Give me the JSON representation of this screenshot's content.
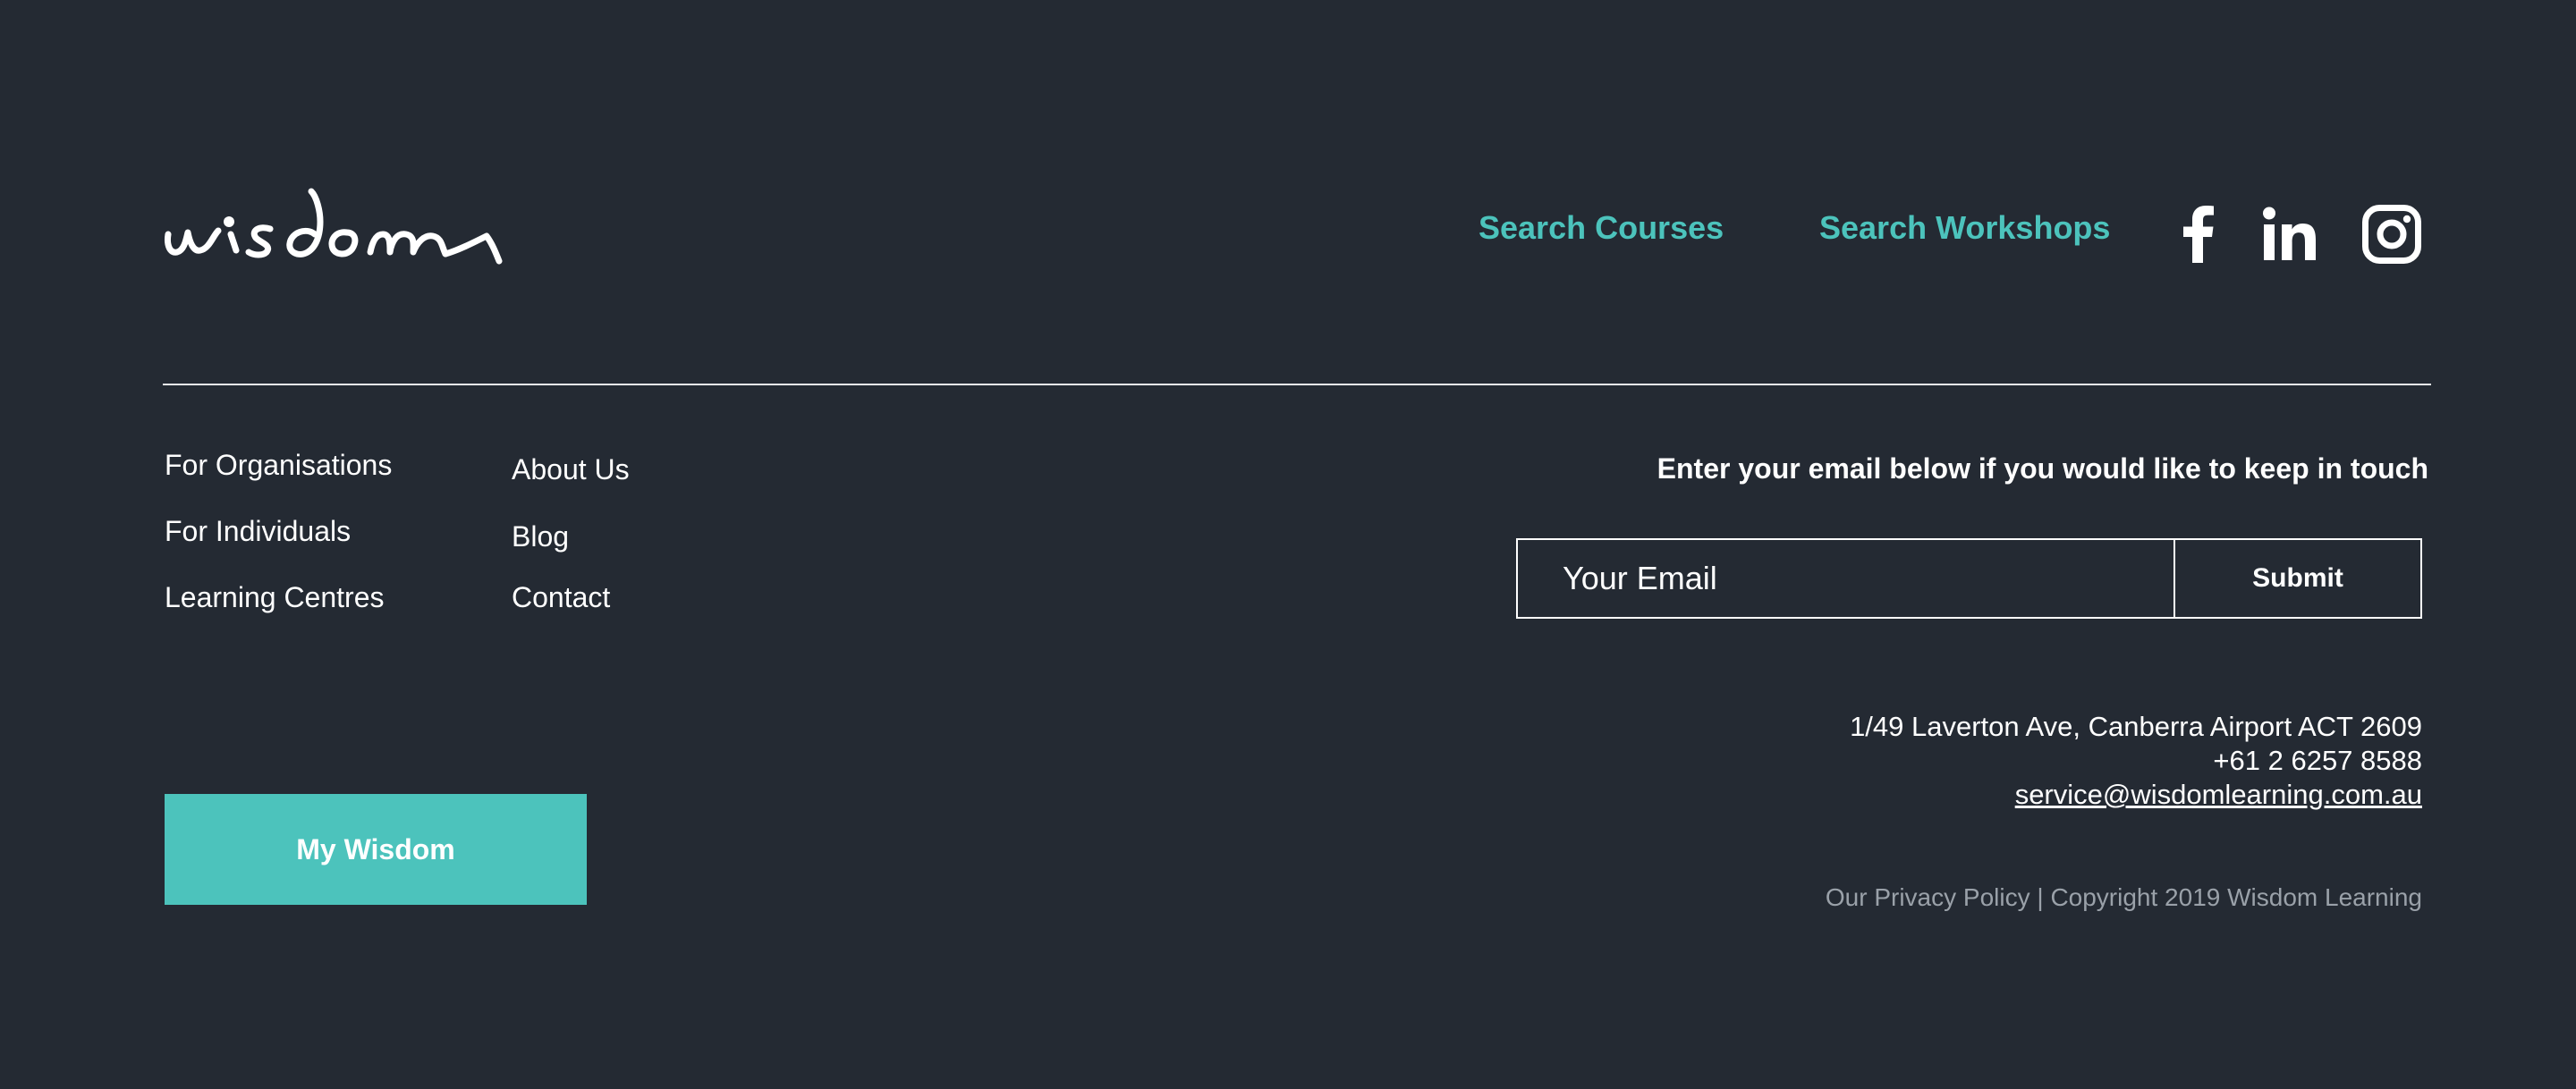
{
  "brand": {
    "logo_text": "wisdom",
    "accent_color": "#4cc3bc",
    "background_color": "#242a33"
  },
  "top_nav": {
    "search_courses": "Search Courses",
    "search_workshops": "Search Workshops",
    "social_icons": [
      "facebook-icon",
      "linkedin-icon",
      "instagram-icon"
    ]
  },
  "nav_col1": [
    "For Organisations",
    "For Individuals",
    "Learning Centres"
  ],
  "nav_col2": [
    "About Us",
    "Blog",
    "Contact"
  ],
  "newsletter": {
    "prompt": "Enter your email below if you would like to keep in touch",
    "placeholder": "Your Email",
    "value": "",
    "submit_label": "Submit"
  },
  "contact": {
    "address": "1/49 Laverton Ave, Canberra Airport ACT 2609",
    "phone": "+61 2 6257 8588",
    "email": "service@wisdomlearning.com.au"
  },
  "legal": {
    "privacy": "Our Privacy Policy",
    "separator": " | ",
    "copyright": "Copyright 2019 Wisdom Learning"
  },
  "my_wisdom_label": "My Wisdom"
}
